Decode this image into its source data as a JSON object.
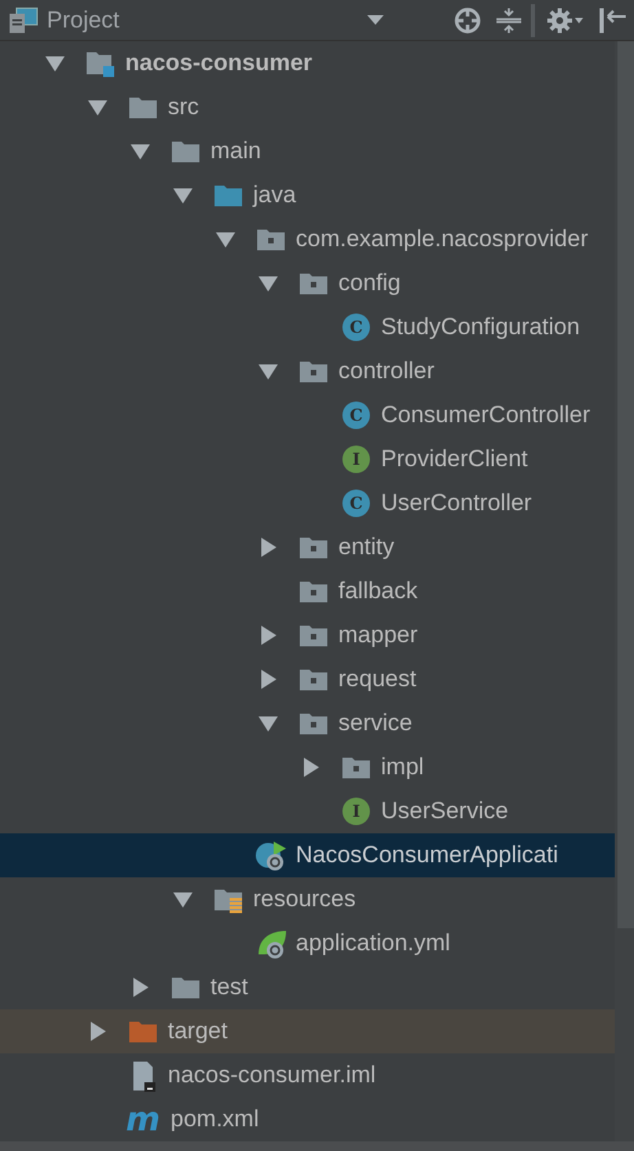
{
  "panel": {
    "title": "Project"
  },
  "tree": [
    {
      "label": "nacos-consumer",
      "kind": "module",
      "expanded": true,
      "selected": false,
      "highlighted": false,
      "children": [
        {
          "label": "src",
          "kind": "folder",
          "expanded": true,
          "selected": false,
          "highlighted": false,
          "children": [
            {
              "label": "main",
              "kind": "folder",
              "expanded": true,
              "selected": false,
              "highlighted": false,
              "children": [
                {
                  "label": "java",
                  "kind": "source-folder",
                  "expanded": true,
                  "selected": false,
                  "highlighted": false,
                  "children": [
                    {
                      "label": "com.example.nacosprovider",
                      "kind": "package",
                      "expanded": true,
                      "selected": false,
                      "highlighted": false,
                      "children": [
                        {
                          "label": "config",
                          "kind": "package",
                          "expanded": true,
                          "selected": false,
                          "highlighted": false,
                          "children": [
                            {
                              "label": "StudyConfiguration",
                              "kind": "class",
                              "badge": "C",
                              "selected": false,
                              "highlighted": false
                            }
                          ]
                        },
                        {
                          "label": "controller",
                          "kind": "package",
                          "expanded": true,
                          "selected": false,
                          "highlighted": false,
                          "children": [
                            {
                              "label": "ConsumerController",
                              "kind": "class",
                              "badge": "C",
                              "selected": false,
                              "highlighted": false
                            },
                            {
                              "label": "ProviderClient",
                              "kind": "interface",
                              "badge": "I",
                              "selected": false,
                              "highlighted": false
                            },
                            {
                              "label": "UserController",
                              "kind": "class",
                              "badge": "C",
                              "selected": false,
                              "highlighted": false
                            }
                          ]
                        },
                        {
                          "label": "entity",
                          "kind": "package",
                          "expanded": false,
                          "selected": false,
                          "highlighted": false
                        },
                        {
                          "label": "fallback",
                          "kind": "package",
                          "selected": false,
                          "highlighted": false
                        },
                        {
                          "label": "mapper",
                          "kind": "package",
                          "expanded": false,
                          "selected": false,
                          "highlighted": false
                        },
                        {
                          "label": "request",
                          "kind": "package",
                          "expanded": false,
                          "selected": false,
                          "highlighted": false
                        },
                        {
                          "label": "service",
                          "kind": "package",
                          "expanded": true,
                          "selected": false,
                          "highlighted": false,
                          "children": [
                            {
                              "label": "impl",
                              "kind": "package",
                              "expanded": false,
                              "selected": false,
                              "highlighted": false
                            },
                            {
                              "label": "UserService",
                              "kind": "interface",
                              "badge": "I",
                              "selected": false,
                              "highlighted": false
                            }
                          ]
                        }
                      ]
                    },
                    {
                      "label": "NacosConsumerApplicati",
                      "kind": "spring-app",
                      "selected": true,
                      "highlighted": false
                    }
                  ]
                },
                {
                  "label": "resources",
                  "kind": "resources",
                  "expanded": true,
                  "selected": false,
                  "highlighted": false,
                  "children": [
                    {
                      "label": "application.yml",
                      "kind": "spring-config",
                      "selected": false,
                      "highlighted": false
                    }
                  ]
                }
              ]
            },
            {
              "label": "test",
              "kind": "folder",
              "expanded": false,
              "selected": false,
              "highlighted": false
            }
          ]
        },
        {
          "label": "target",
          "kind": "excluded-folder",
          "expanded": false,
          "selected": false,
          "highlighted": true
        },
        {
          "label": "nacos-consumer.iml",
          "kind": "iml",
          "selected": false,
          "highlighted": false
        },
        {
          "label": "pom.xml",
          "kind": "maven",
          "badge": "m",
          "selected": false,
          "highlighted": false
        }
      ]
    }
  ]
}
